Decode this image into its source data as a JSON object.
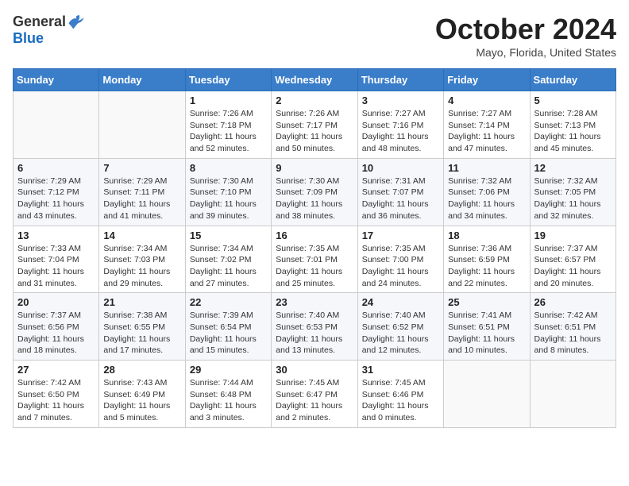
{
  "header": {
    "logo": {
      "general": "General",
      "blue": "Blue"
    },
    "title": "October 2024",
    "location": "Mayo, Florida, United States"
  },
  "weekdays": [
    "Sunday",
    "Monday",
    "Tuesday",
    "Wednesday",
    "Thursday",
    "Friday",
    "Saturday"
  ],
  "weeks": [
    [
      {
        "day": "",
        "sunrise": "",
        "sunset": "",
        "daylight": ""
      },
      {
        "day": "",
        "sunrise": "",
        "sunset": "",
        "daylight": ""
      },
      {
        "day": "1",
        "sunrise": "Sunrise: 7:26 AM",
        "sunset": "Sunset: 7:18 PM",
        "daylight": "Daylight: 11 hours and 52 minutes."
      },
      {
        "day": "2",
        "sunrise": "Sunrise: 7:26 AM",
        "sunset": "Sunset: 7:17 PM",
        "daylight": "Daylight: 11 hours and 50 minutes."
      },
      {
        "day": "3",
        "sunrise": "Sunrise: 7:27 AM",
        "sunset": "Sunset: 7:16 PM",
        "daylight": "Daylight: 11 hours and 48 minutes."
      },
      {
        "day": "4",
        "sunrise": "Sunrise: 7:27 AM",
        "sunset": "Sunset: 7:14 PM",
        "daylight": "Daylight: 11 hours and 47 minutes."
      },
      {
        "day": "5",
        "sunrise": "Sunrise: 7:28 AM",
        "sunset": "Sunset: 7:13 PM",
        "daylight": "Daylight: 11 hours and 45 minutes."
      }
    ],
    [
      {
        "day": "6",
        "sunrise": "Sunrise: 7:29 AM",
        "sunset": "Sunset: 7:12 PM",
        "daylight": "Daylight: 11 hours and 43 minutes."
      },
      {
        "day": "7",
        "sunrise": "Sunrise: 7:29 AM",
        "sunset": "Sunset: 7:11 PM",
        "daylight": "Daylight: 11 hours and 41 minutes."
      },
      {
        "day": "8",
        "sunrise": "Sunrise: 7:30 AM",
        "sunset": "Sunset: 7:10 PM",
        "daylight": "Daylight: 11 hours and 39 minutes."
      },
      {
        "day": "9",
        "sunrise": "Sunrise: 7:30 AM",
        "sunset": "Sunset: 7:09 PM",
        "daylight": "Daylight: 11 hours and 38 minutes."
      },
      {
        "day": "10",
        "sunrise": "Sunrise: 7:31 AM",
        "sunset": "Sunset: 7:07 PM",
        "daylight": "Daylight: 11 hours and 36 minutes."
      },
      {
        "day": "11",
        "sunrise": "Sunrise: 7:32 AM",
        "sunset": "Sunset: 7:06 PM",
        "daylight": "Daylight: 11 hours and 34 minutes."
      },
      {
        "day": "12",
        "sunrise": "Sunrise: 7:32 AM",
        "sunset": "Sunset: 7:05 PM",
        "daylight": "Daylight: 11 hours and 32 minutes."
      }
    ],
    [
      {
        "day": "13",
        "sunrise": "Sunrise: 7:33 AM",
        "sunset": "Sunset: 7:04 PM",
        "daylight": "Daylight: 11 hours and 31 minutes."
      },
      {
        "day": "14",
        "sunrise": "Sunrise: 7:34 AM",
        "sunset": "Sunset: 7:03 PM",
        "daylight": "Daylight: 11 hours and 29 minutes."
      },
      {
        "day": "15",
        "sunrise": "Sunrise: 7:34 AM",
        "sunset": "Sunset: 7:02 PM",
        "daylight": "Daylight: 11 hours and 27 minutes."
      },
      {
        "day": "16",
        "sunrise": "Sunrise: 7:35 AM",
        "sunset": "Sunset: 7:01 PM",
        "daylight": "Daylight: 11 hours and 25 minutes."
      },
      {
        "day": "17",
        "sunrise": "Sunrise: 7:35 AM",
        "sunset": "Sunset: 7:00 PM",
        "daylight": "Daylight: 11 hours and 24 minutes."
      },
      {
        "day": "18",
        "sunrise": "Sunrise: 7:36 AM",
        "sunset": "Sunset: 6:59 PM",
        "daylight": "Daylight: 11 hours and 22 minutes."
      },
      {
        "day": "19",
        "sunrise": "Sunrise: 7:37 AM",
        "sunset": "Sunset: 6:57 PM",
        "daylight": "Daylight: 11 hours and 20 minutes."
      }
    ],
    [
      {
        "day": "20",
        "sunrise": "Sunrise: 7:37 AM",
        "sunset": "Sunset: 6:56 PM",
        "daylight": "Daylight: 11 hours and 18 minutes."
      },
      {
        "day": "21",
        "sunrise": "Sunrise: 7:38 AM",
        "sunset": "Sunset: 6:55 PM",
        "daylight": "Daylight: 11 hours and 17 minutes."
      },
      {
        "day": "22",
        "sunrise": "Sunrise: 7:39 AM",
        "sunset": "Sunset: 6:54 PM",
        "daylight": "Daylight: 11 hours and 15 minutes."
      },
      {
        "day": "23",
        "sunrise": "Sunrise: 7:40 AM",
        "sunset": "Sunset: 6:53 PM",
        "daylight": "Daylight: 11 hours and 13 minutes."
      },
      {
        "day": "24",
        "sunrise": "Sunrise: 7:40 AM",
        "sunset": "Sunset: 6:52 PM",
        "daylight": "Daylight: 11 hours and 12 minutes."
      },
      {
        "day": "25",
        "sunrise": "Sunrise: 7:41 AM",
        "sunset": "Sunset: 6:51 PM",
        "daylight": "Daylight: 11 hours and 10 minutes."
      },
      {
        "day": "26",
        "sunrise": "Sunrise: 7:42 AM",
        "sunset": "Sunset: 6:51 PM",
        "daylight": "Daylight: 11 hours and 8 minutes."
      }
    ],
    [
      {
        "day": "27",
        "sunrise": "Sunrise: 7:42 AM",
        "sunset": "Sunset: 6:50 PM",
        "daylight": "Daylight: 11 hours and 7 minutes."
      },
      {
        "day": "28",
        "sunrise": "Sunrise: 7:43 AM",
        "sunset": "Sunset: 6:49 PM",
        "daylight": "Daylight: 11 hours and 5 minutes."
      },
      {
        "day": "29",
        "sunrise": "Sunrise: 7:44 AM",
        "sunset": "Sunset: 6:48 PM",
        "daylight": "Daylight: 11 hours and 3 minutes."
      },
      {
        "day": "30",
        "sunrise": "Sunrise: 7:45 AM",
        "sunset": "Sunset: 6:47 PM",
        "daylight": "Daylight: 11 hours and 2 minutes."
      },
      {
        "day": "31",
        "sunrise": "Sunrise: 7:45 AM",
        "sunset": "Sunset: 6:46 PM",
        "daylight": "Daylight: 11 hours and 0 minutes."
      },
      {
        "day": "",
        "sunrise": "",
        "sunset": "",
        "daylight": ""
      },
      {
        "day": "",
        "sunrise": "",
        "sunset": "",
        "daylight": ""
      }
    ]
  ]
}
